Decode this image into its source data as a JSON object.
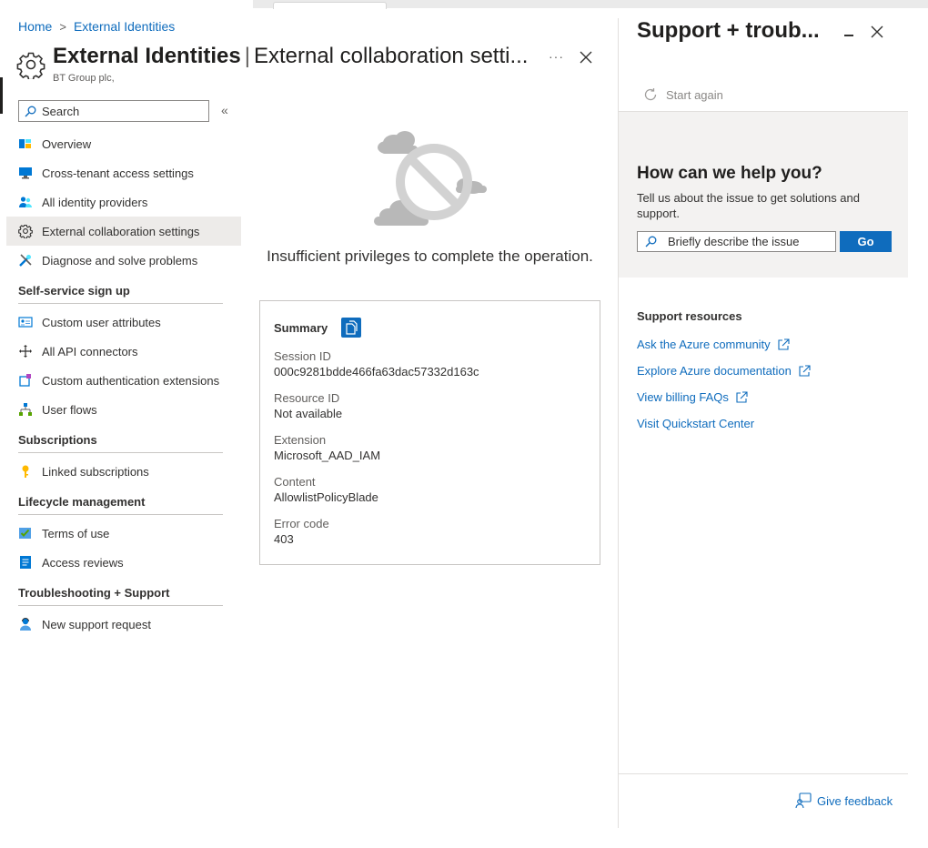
{
  "breadcrumb": {
    "home": "Home",
    "current": "External Identities",
    "separator": ">"
  },
  "header": {
    "title_bold": "External Identities",
    "separator": "|",
    "title_rest": "External collaboration setti...",
    "subtitle": "BT Group plc,",
    "more_label": "···"
  },
  "search": {
    "placeholder": "Search",
    "collapse_label": "«"
  },
  "nav": {
    "items": [
      {
        "label": "Overview",
        "icon": "overview-icon"
      },
      {
        "label": "Cross-tenant access settings",
        "icon": "monitor-icon"
      },
      {
        "label": "All identity providers",
        "icon": "users-icon"
      },
      {
        "label": "External collaboration settings",
        "icon": "gear-icon",
        "active": true
      },
      {
        "label": "Diagnose and solve problems",
        "icon": "tools-icon"
      }
    ],
    "sections": [
      {
        "title": "Self-service sign up",
        "items": [
          {
            "label": "Custom user attributes",
            "icon": "id-card-icon"
          },
          {
            "label": "All API connectors",
            "icon": "connector-icon"
          },
          {
            "label": "Custom authentication extensions",
            "icon": "extension-icon"
          },
          {
            "label": "User flows",
            "icon": "flow-icon"
          }
        ]
      },
      {
        "title": "Subscriptions",
        "items": [
          {
            "label": "Linked subscriptions",
            "icon": "key-icon"
          }
        ]
      },
      {
        "title": "Lifecycle management",
        "items": [
          {
            "label": "Terms of use",
            "icon": "checklist-icon"
          },
          {
            "label": "Access reviews",
            "icon": "review-icon"
          }
        ]
      },
      {
        "title": "Troubleshooting + Support",
        "items": [
          {
            "label": "New support request",
            "icon": "support-person-icon"
          }
        ]
      }
    ]
  },
  "error": {
    "message": "Insufficient privileges to complete the operation.",
    "summary_title": "Summary",
    "fields": [
      {
        "label": "Session ID",
        "value": "000c9281bdde466fa63dac57332d163c"
      },
      {
        "label": "Resource ID",
        "value": "Not available"
      },
      {
        "label": "Extension",
        "value": "Microsoft_AAD_IAM"
      },
      {
        "label": "Content",
        "value": "AllowlistPolicyBlade"
      },
      {
        "label": "Error code",
        "value": "403"
      }
    ]
  },
  "support_panel": {
    "title": "Support + troub...",
    "start_again": "Start again",
    "help_title": "How can we help you?",
    "help_desc": "Tell us about the issue to get solutions and support.",
    "help_placeholder": "Briefly describe the issue",
    "go_label": "Go",
    "resources_title": "Support resources",
    "resources": [
      {
        "label": "Ask the Azure community",
        "external": true
      },
      {
        "label": "Explore Azure documentation",
        "external": true
      },
      {
        "label": "View billing FAQs",
        "external": true
      },
      {
        "label": "Visit Quickstart Center",
        "external": false
      }
    ],
    "feedback_label": "Give feedback"
  },
  "colors": {
    "accent": "#0f6cbd",
    "active_bg": "#edebe9",
    "panel_bg": "#f3f2f1"
  }
}
